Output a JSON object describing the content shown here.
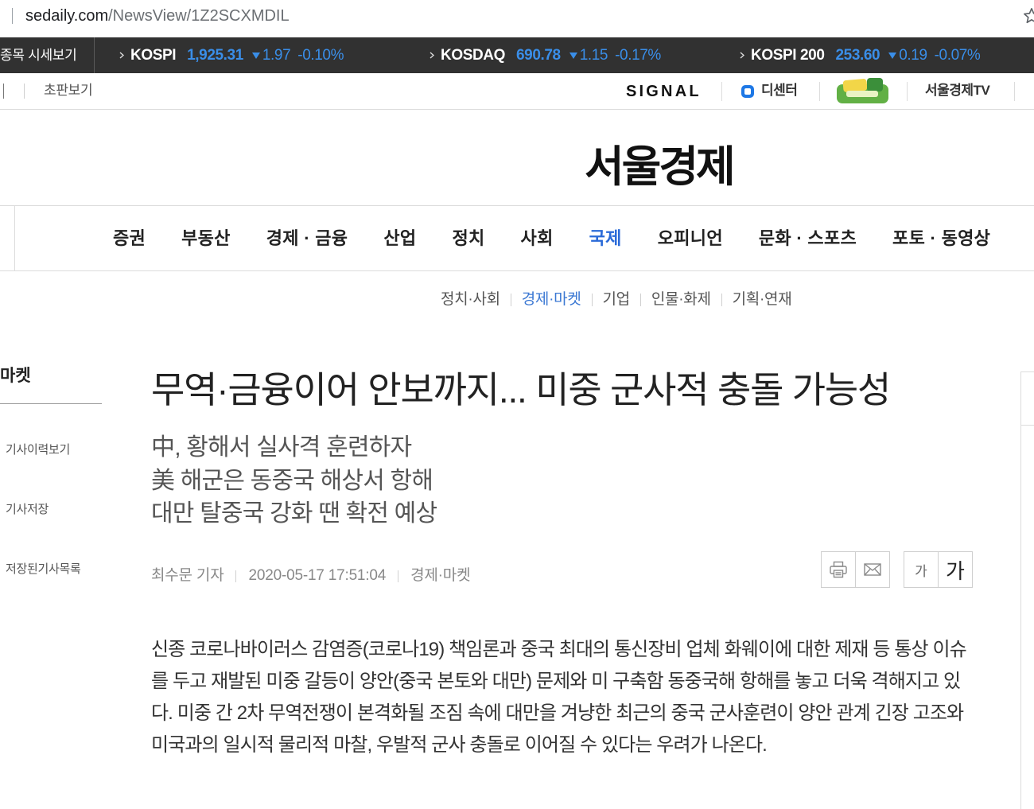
{
  "browser": {
    "url_domain": "sedaily.com",
    "url_path": "/NewsView/1Z2SCXMDIL",
    "bookmark_icon": "star-outline-icon"
  },
  "colors": {
    "ticker_background": "#313131",
    "ticker_value": "#3a8ee8",
    "accent": "#2a6ad8",
    "sub_accent": "#3b78d3"
  },
  "ticker": {
    "label": "종목 시세보기",
    "items": [
      {
        "name": "KOSPI",
        "value": "1,925.31",
        "direction": "down",
        "change": "1.97",
        "percent": "-0.10%"
      },
      {
        "name": "KOSDAQ",
        "value": "690.78",
        "direction": "down",
        "change": "1.15",
        "percent": "-0.17%"
      },
      {
        "name": "KOSPI 200",
        "value": "253.60",
        "direction": "down",
        "change": "0.19",
        "percent": "-0.07%"
      }
    ]
  },
  "utility": {
    "left_link": "초판보기",
    "signal_logo": "SIGNAL",
    "decenter_label": "디센터",
    "tv_label": "서울경제TV"
  },
  "site": {
    "logo": "서울경제"
  },
  "nav": {
    "items": [
      "증권",
      "부동산",
      "경제 · 금융",
      "산업",
      "정치",
      "사회",
      "국제",
      "오피니언",
      "문화 · 스포츠",
      "포토 · 동영상"
    ],
    "active": "국제"
  },
  "subnav": {
    "items": [
      "정치·사회",
      "경제·마켓",
      "기업",
      "인물·화제",
      "기획·연재"
    ],
    "active": "경제·마켓"
  },
  "sidebar": {
    "title": "마켓",
    "actions": [
      "기사이력보기",
      "기사저장",
      "저장된기사목록"
    ]
  },
  "article": {
    "title": "무역·금융이어 안보까지... 미중 군사적 충돌 가능성",
    "subtitles": [
      "中, 황해서 실사격 훈련하자",
      "美 해군은 동중국 해상서 항해",
      "대만 탈중국 강화 땐 확전 예상"
    ],
    "reporter": "최수문 기자",
    "datetime": "2020-05-17 17:51:04",
    "section": "경제·마켓",
    "tools": {
      "print_icon": "print-icon",
      "email_icon": "mail-icon",
      "font_small": "가",
      "font_large": "가"
    },
    "body": "신종 코로나바이러스 감염증(코로나19) 책임론과 중국 최대의 통신장비 업체 화웨이에 대한 제재 등 통상 이슈를 두고 재발된 미중 갈등이 양안(중국 본토와 대만) 문제와 미 구축함 동중국해 항해를 놓고 더욱 격해지고 있다. 미중 간 2차 무역전쟁이 본격화될 조짐 속에 대만을 겨냥한 최근의 중국 군사훈련이 양안 관계 긴장 고조와 미국과의 일시적 물리적 마찰, 우발적 군사 충돌로 이어질 수 있다는 우려가 나온다."
  }
}
